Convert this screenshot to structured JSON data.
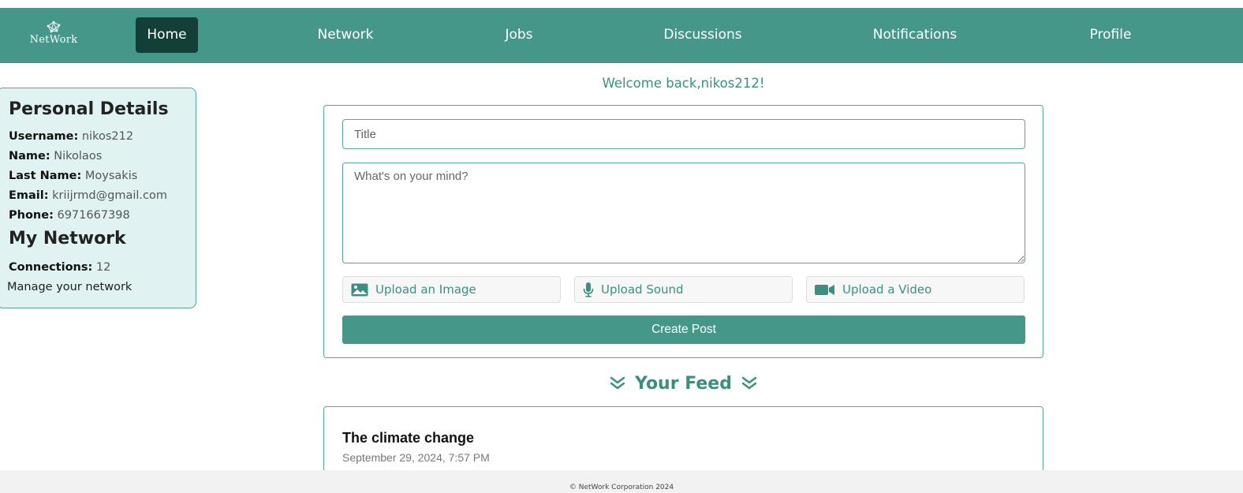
{
  "navbar": {
    "logo_text": "NetWork",
    "items": [
      {
        "label": "Home",
        "active": true
      },
      {
        "label": "Network",
        "active": false
      },
      {
        "label": "Jobs",
        "active": false
      },
      {
        "label": "Discussions",
        "active": false
      },
      {
        "label": "Notifications",
        "active": false
      },
      {
        "label": "Profile",
        "active": false
      }
    ]
  },
  "personal": {
    "heading": "Personal Details",
    "username_label": "Username:",
    "username": "nikos212",
    "name_label": "Name:",
    "name": "Nikolaos",
    "lastname_label": "Last Name:",
    "lastname": "Moysakis",
    "email_label": "Email:",
    "email": "kriijrmd@gmail.com",
    "phone_label": "Phone:",
    "phone": "6971667398"
  },
  "network": {
    "heading": "My Network",
    "connections_label": "Connections:",
    "connections": "12",
    "manage_link": "Manage your network"
  },
  "welcome": "Welcome back,nikos212!",
  "post_form": {
    "title_placeholder": "Title",
    "body_placeholder": "What's on your mind?",
    "upload_image": "Upload an Image",
    "upload_sound": "Upload Sound",
    "upload_video": "Upload a Video",
    "submit": "Create Post"
  },
  "feed": {
    "heading": "Your Feed",
    "posts": [
      {
        "title": "The climate change",
        "date": "September 29, 2024, 7:57 PM"
      }
    ]
  },
  "footer": "© NetWork Corporation 2024",
  "colors": {
    "primary": "#45978a",
    "active_nav": "#123f38",
    "panel_bg": "#e0f2f2",
    "accent_text": "#3b8f82"
  }
}
